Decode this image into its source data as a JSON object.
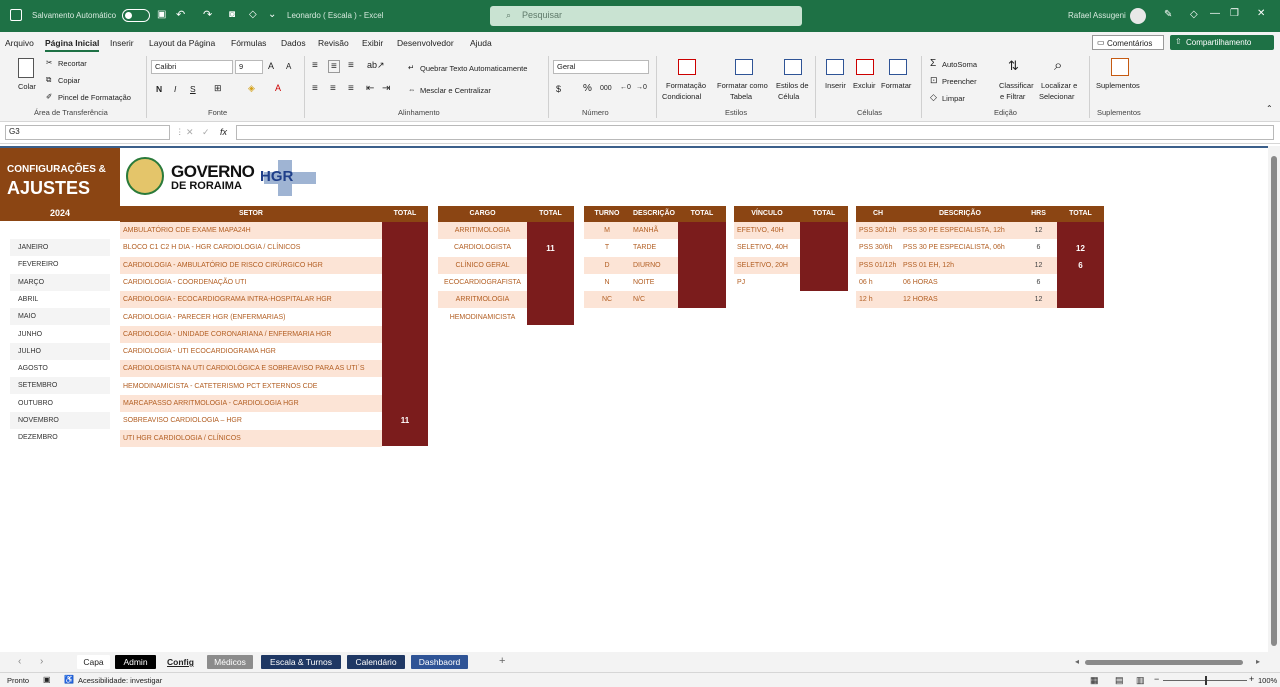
{
  "titlebar": {
    "autosave_label": "Salvamento Automático",
    "doc_title": "Leonardo ( Escala )  -  Excel",
    "search_placeholder": "Pesquisar",
    "user": "Rafael Assugeni"
  },
  "menu": [
    "Arquivo",
    "Página Inicial",
    "Inserir",
    "Layout da Página",
    "Fórmulas",
    "Dados",
    "Revisão",
    "Exibir",
    "Desenvolvedor",
    "Ajuda"
  ],
  "menu_right": {
    "comments": "Comentários",
    "share": "Compartilhamento"
  },
  "ribbon": {
    "clipboard": {
      "paste": "Colar",
      "cut": "Recortar",
      "copy": "Copiar",
      "format_painter": "Pincel de Formatação",
      "group": "Área de Transferência"
    },
    "font": {
      "name": "Calibri",
      "size": "9",
      "bold": "N",
      "italic": "I",
      "underline": "S",
      "grow": "A",
      "shrink": "A",
      "group": "Fonte"
    },
    "alignment": {
      "wrap": "Quebrar Texto Automaticamente",
      "merge": "Mesclar e Centralizar",
      "group": "Alinhamento"
    },
    "number": {
      "format": "Geral",
      "percent": "%",
      "thousands": "000",
      "group": "Número"
    },
    "styles": {
      "cond": "Formatação",
      "cond2": "Condicional",
      "table": "Formatar como",
      "table2": "Tabela",
      "cell": "Estilos de",
      "cell2": "Célula",
      "group": "Estilos"
    },
    "cells": {
      "insert": "Inserir",
      "delete": "Excluir",
      "format": "Formatar",
      "group": "Células"
    },
    "editing": {
      "autosum": "AutoSoma",
      "fill": "Preencher",
      "clear": "Limpar",
      "sort": "Classificar",
      "sort2": "e Filtrar",
      "find": "Localizar e",
      "find2": "Selecionar",
      "group": "Edição"
    },
    "addins": {
      "label": "Suplementos",
      "group": "Suplementos"
    }
  },
  "formula": {
    "namebox": "G3",
    "fx": "fx"
  },
  "sheet": {
    "title_line1": "CONFIGURAÇÕES &",
    "title_line2": "AJUSTES",
    "year": "2024",
    "logo_text1": "GOVERNO",
    "logo_text2": "DE RORAIMA",
    "logo_hgr": "HGR",
    "months": [
      "JANEIRO",
      "FEVEREIRO",
      "MARÇO",
      "ABRIL",
      "MAIO",
      "JUNHO",
      "JULHO",
      "AGOSTO",
      "SETEMBRO",
      "OUTUBRO",
      "NOVEMBRO",
      "DEZEMBRO"
    ],
    "setor": {
      "header": "SETOR",
      "total_header": "TOTAL",
      "items": [
        "AMBULATÓRIO CDE EXAME MAPA24H",
        "BLOCO C1 C2 H DIA - HGR CARDIOLOGIA / CLÍNICOS",
        "CARDIOLOGIA -  AMBULATÓRIO DE  RISCO CIRÚRGICO  HGR",
        "CARDIOLOGIA -  COORDENAÇÃO  UTI",
        "CARDIOLOGIA -  ECOCARDIOGRAMA INTRA-HOSPITALAR HGR",
        "CARDIOLOGIA -  PARECER  HGR (ENFERMARIAS)",
        "CARDIOLOGIA -  UNIDADE CORONARIANA  / ENFERMARIA  HGR",
        "CARDIOLOGIA - UTI  ECOCARDIOGRAMA HGR",
        "CARDIOLOGISTA NA UTI CARDIOLÓGICA E SOBREAVISO PARA AS UTI´S",
        "HEMODINAMICISTA - CATETERISMO PCT EXTERNOS CDE",
        "MARCAPASSO ARRITMOLOGIA - CARDIOLOGIA HGR",
        "SOBREAVISO CARDIOLOGIA – HGR",
        "UTI HGR CARDIOLOGIA / CLÍNICOS"
      ],
      "total_value": "11"
    },
    "cargo": {
      "header": "CARGO",
      "total_header": "TOTAL",
      "items": [
        "ARRITIMOLOGIA",
        "CARDIOLOGISTA",
        "CLÍNICO GERAL",
        "ECOCARDIOGRAFISTA",
        "ARRITMOLOGIA",
        "HEMODINAMICISTA"
      ],
      "total_value": "11"
    },
    "turno": {
      "header": "TURNO",
      "desc_header": "DESCRIÇÃO",
      "total_header": "TOTAL",
      "items": [
        {
          "code": "M",
          "desc": "MANHÃ"
        },
        {
          "code": "T",
          "desc": "TARDE"
        },
        {
          "code": "D",
          "desc": "DIURNO"
        },
        {
          "code": "N",
          "desc": "NOITE"
        },
        {
          "code": "NC",
          "desc": "N/C"
        }
      ]
    },
    "vinculo": {
      "header": "VÍNCULO",
      "total_header": "TOTAL",
      "items": [
        "EFETIVO, 40H",
        "SELETIVO, 40H",
        "SELETIVO, 20H",
        "PJ"
      ]
    },
    "ch": {
      "header": "CH",
      "desc_header": "DESCRIÇÃO",
      "hrs_header": "HRS",
      "total_header": "TOTAL",
      "items": [
        {
          "ch": "PSS 30/12h",
          "desc": "PSS 30 PE ESPECIALISTA, 12h",
          "hrs": "12"
        },
        {
          "ch": "PSS 30/6h",
          "desc": "PSS 30 PE ESPECIALISTA, 06h",
          "hrs": "6"
        },
        {
          "ch": "PSS 01/12h",
          "desc": "PSS 01 EH, 12h",
          "hrs": "12"
        },
        {
          "ch": "06 h",
          "desc": "06 HORAS",
          "hrs": "6"
        },
        {
          "ch": "12 h",
          "desc": "12 HORAS",
          "hrs": "12"
        }
      ],
      "total_values": [
        "12",
        "6"
      ]
    }
  },
  "tabs": [
    {
      "label": "Capa",
      "bg": "#ffffff",
      "fg": "#222222"
    },
    {
      "label": "Admin",
      "bg": "#000000",
      "fg": "#ffffff"
    },
    {
      "label": "Config",
      "bg": "#f3f3f3",
      "fg": "#222222"
    },
    {
      "label": "Médicos",
      "bg": "#8c8c8c",
      "fg": "#ffffff"
    },
    {
      "label": "Escala & Turnos",
      "bg": "#1f3864",
      "fg": "#ffffff"
    },
    {
      "label": "Calendário",
      "bg": "#1f3864",
      "fg": "#ffffff"
    },
    {
      "label": "Dashbaord",
      "bg": "#2f5496",
      "fg": "#ffffff"
    }
  ],
  "status": {
    "ready": "Pronto",
    "accessibility": "Acessibilidade: investigar",
    "zoom": "100%"
  },
  "colors": {
    "brand": "#1e7145",
    "header_brown": "#8b4513",
    "total_maroon": "#7b1c1c",
    "row_peach": "#fce4d6",
    "text_orange": "#b25e22"
  }
}
